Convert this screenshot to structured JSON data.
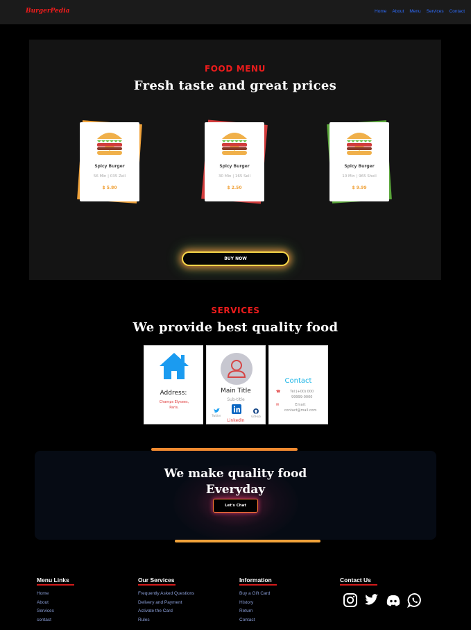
{
  "nav": {
    "logo": "BurgerPedia",
    "links": [
      "Home",
      "About",
      "Menu",
      "Services",
      "Contact"
    ]
  },
  "menu_section": {
    "label": "FOOD MENU",
    "title": "Fresh taste and great prices",
    "cards": [
      {
        "name": "Spicy Burger",
        "meta": "56 Min | 035 Zell",
        "price": "$ 5.80",
        "accent": "#f0a23a"
      },
      {
        "name": "Spicy Burger",
        "meta": "30 Min | 165 Sell",
        "price": "$ 2.50",
        "accent": "#d13b3b"
      },
      {
        "name": "Spicy Burger",
        "meta": "10 Min | 965 Shell",
        "price": "$ 9.99",
        "accent": "#5aa63a"
      }
    ],
    "buy_button": "BUY NOW"
  },
  "services": {
    "label": "SERVICES",
    "title": "We provide best quality food",
    "address_card": {
      "label": "Address:",
      "value": "Champs Elysees, Paris."
    },
    "profile_card": {
      "title": "Main Title",
      "subtitle": "Sub-title",
      "social": [
        "Twitter",
        "LinkedIn",
        "GitHub"
      ],
      "linkedin_label": "LinkedIn"
    },
    "contact_card": {
      "title": "Contact",
      "phone": "Tel:(+00) 000 99999-0000",
      "email": "Email: contact@mail.com"
    }
  },
  "cta": {
    "title_line1": "We make quality food",
    "title_line2": "Everyday",
    "button": "Let's Chat"
  },
  "footer": {
    "columns": [
      {
        "heading": "Menu Links",
        "links": [
          "Home",
          "About",
          "Services",
          "contact"
        ]
      },
      {
        "heading": "Our Services",
        "links": [
          "Frequently Asked Questions",
          "Delivery and Payment",
          "Activate the Card",
          "Rules"
        ]
      },
      {
        "heading": "Information",
        "links": [
          "Buy a Gift Card",
          "History",
          "Return",
          "Contact"
        ]
      },
      {
        "heading": "Contact Us",
        "links": []
      }
    ],
    "social_icons": [
      "instagram-icon",
      "twitter-icon",
      "discord-icon",
      "whatsapp-icon"
    ]
  },
  "colors": {
    "accent_red": "#ee1c1c",
    "nav_link": "#2f6dff",
    "price": "#f0a23a",
    "contact_blue": "#19b4e6"
  }
}
